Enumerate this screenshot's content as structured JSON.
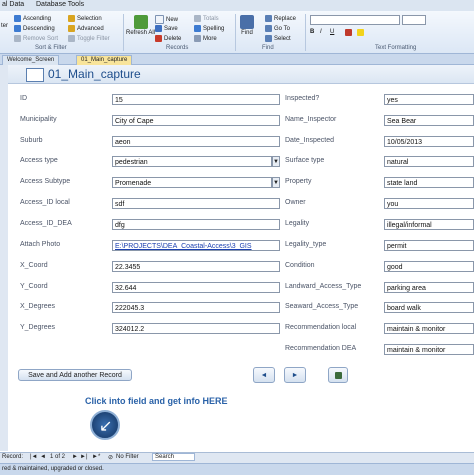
{
  "ribbon": {
    "tabs": [
      "al Data",
      "Database Tools"
    ],
    "sort_filter": {
      "ascending": "Ascending",
      "descending": "Descending",
      "remove_sort": "Remove Sort",
      "selection": "Selection",
      "advanced": "Advanced",
      "toggle_filter": "Toggle Filter",
      "group": "Sort & Filter"
    },
    "records": {
      "refresh_all": "Refresh All",
      "new": "New",
      "save": "Save",
      "delete": "Delete",
      "totals": "Totals",
      "spelling": "Spelling",
      "more": "More",
      "group": "Records"
    },
    "find": {
      "find": "Find",
      "replace": "Replace",
      "go_to": "Go To",
      "select": "Select",
      "group": "Find"
    },
    "text_formatting": {
      "group": "Text Formatting"
    },
    "left_fragment": "ter"
  },
  "doc_tabs": [
    "Welcome_Screen",
    "01_Main_capture"
  ],
  "form": {
    "title": "01_Main_capture",
    "left_fields": [
      {
        "label": "ID",
        "value": "15"
      },
      {
        "label": "Municipality",
        "value": "City of Cape"
      },
      {
        "label": "Suburb",
        "value": "aeon"
      },
      {
        "label": "Access type",
        "value": "pedestrian"
      },
      {
        "label": "Access Subtype",
        "value": "Promenade"
      },
      {
        "label": "Access_ID local",
        "value": "sdf"
      },
      {
        "label": "Access_ID_DEA",
        "value": "dfg"
      },
      {
        "label": "Attach Photo",
        "value": "E:\\PROJECTS\\DEA_Coastal-Access\\3_GIS"
      },
      {
        "label": "X_Coord",
        "value": "22.3455"
      },
      {
        "label": "Y_Coord",
        "value": "32.644"
      },
      {
        "label": "X_Degrees",
        "value": "222045.3"
      },
      {
        "label": "Y_Degrees",
        "value": "324012.2"
      }
    ],
    "right_fields": [
      {
        "label": "Inspected?",
        "value": "yes"
      },
      {
        "label": "Name_Inspector",
        "value": "Sea Bear"
      },
      {
        "label": "Date_Inspected",
        "value": "10/05/2013"
      },
      {
        "label": "Surface type",
        "value": "natural"
      },
      {
        "label": "Property",
        "value": "state land"
      },
      {
        "label": "Owner",
        "value": "you"
      },
      {
        "label": "Legality",
        "value": "illegal/informal"
      },
      {
        "label": "Legality_type",
        "value": "permit"
      },
      {
        "label": "Condition",
        "value": "good"
      },
      {
        "label": "Landward_Access_Type",
        "value": "parking area"
      },
      {
        "label": "Seaward_Access_Type",
        "value": "board walk"
      },
      {
        "label": "Recommendation local",
        "value": "maintain & monitor"
      },
      {
        "label": "Recommendation DEA",
        "value": "maintain & monitor"
      }
    ],
    "save_button": "Save and Add another Record",
    "prev_button": "◄",
    "next_button": "►",
    "hint": "Click into field and get info HERE"
  },
  "record_nav": {
    "record_label": "Record: ",
    "position": "1 of 2",
    "filter": "No Filter",
    "search": "Search"
  },
  "status_bar": "red & maintained, upgraded or closed."
}
